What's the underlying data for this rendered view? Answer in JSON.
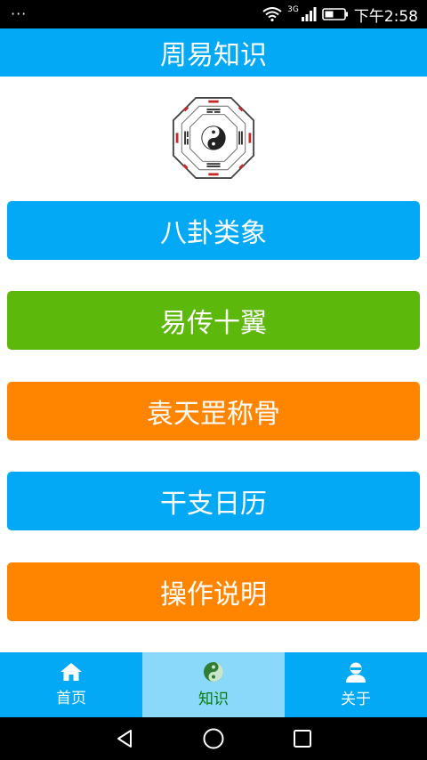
{
  "status_bar": {
    "notification_icon": "more-dots-icon",
    "network_label": "3G",
    "time": "下午2:58"
  },
  "header": {
    "title": "周易知识"
  },
  "logo": {
    "icon": "bagua-icon"
  },
  "menu": {
    "items": [
      {
        "label": "八卦类象",
        "color": "#03a9f4"
      },
      {
        "label": "易传十翼",
        "color": "#5cb80a"
      },
      {
        "label": "袁天罡称骨",
        "color": "#ff8500"
      },
      {
        "label": "干支日历",
        "color": "#03a9f4"
      },
      {
        "label": "操作说明",
        "color": "#ff8500"
      }
    ]
  },
  "tabbar": {
    "tabs": [
      {
        "label": "首页",
        "icon": "home-icon",
        "active": false
      },
      {
        "label": "知识",
        "icon": "yin-yang-icon",
        "active": true
      },
      {
        "label": "关于",
        "icon": "user-icon",
        "active": false
      }
    ]
  },
  "nav": {
    "back": "back-icon",
    "home": "home-circle-icon",
    "recents": "recents-icon"
  }
}
